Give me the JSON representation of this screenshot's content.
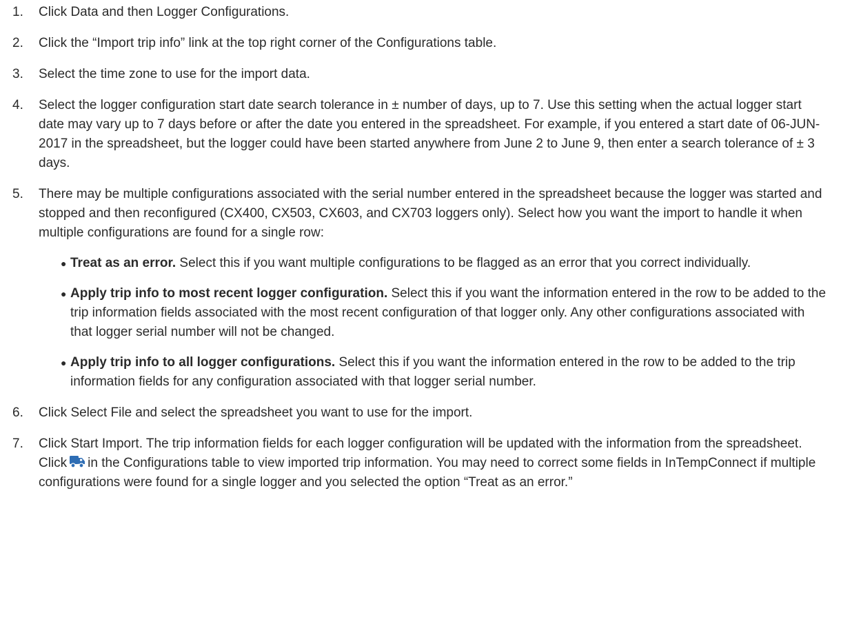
{
  "steps": [
    {
      "number": "1.",
      "text": "Click Data and then Logger Configurations."
    },
    {
      "number": "2.",
      "text": "Click the “Import trip info” link at the top right corner of the Configurations table."
    },
    {
      "number": "3.",
      "text": "Select the time zone to use for the import data."
    },
    {
      "number": "4.",
      "text": "Select the logger configuration start date search tolerance in ± number of days, up to 7. Use this setting when the actual logger start date may vary up to 7 days before or after the date you entered in the spreadsheet. For example, if you entered a start date of 06-JUN-2017 in the spreadsheet, but the logger could have been started anywhere from June 2 to June 9, then enter a search tolerance of ± 3 days."
    },
    {
      "number": "5.",
      "text": "There may be multiple configurations associated with the serial number entered in the spreadsheet because the logger was started and stopped and then reconfigured (CX400, CX503, CX603, and CX703 loggers only). Select how you want the import to handle it when multiple configurations are found for a single row:",
      "bullets": [
        {
          "bold": "Treat as an error.",
          "text": " Select this if you want multiple configurations to be flagged as an error that you correct individually."
        },
        {
          "bold": "Apply trip info to most recent logger configuration.",
          "text": " Select this if you want the information entered in the row to be added to the trip information fields associated with the most recent configuration of that logger only. Any other configurations associated with that logger serial number will not be changed."
        },
        {
          "bold": "Apply trip info to all logger configurations.",
          "text": " Select this if you want the information entered in the row to be added to the trip information fields for any configuration associated with that logger serial number."
        }
      ]
    },
    {
      "number": "6.",
      "text": "Click Select File and select the spreadsheet you want to use for the import."
    },
    {
      "number": "7.",
      "text_before": "Click Start Import. The trip information fields for each logger configuration will be updated with the information from the spreadsheet. Click",
      "icon": "truck-icon",
      "text_after": "in the Configurations table to view imported trip information. You may need to correct some fields in InTempConnect if multiple configurations were found for a single logger and you selected the option “Treat as an error.”"
    }
  ],
  "colors": {
    "text": "#2b2b2b",
    "icon": "#2e6db4"
  }
}
